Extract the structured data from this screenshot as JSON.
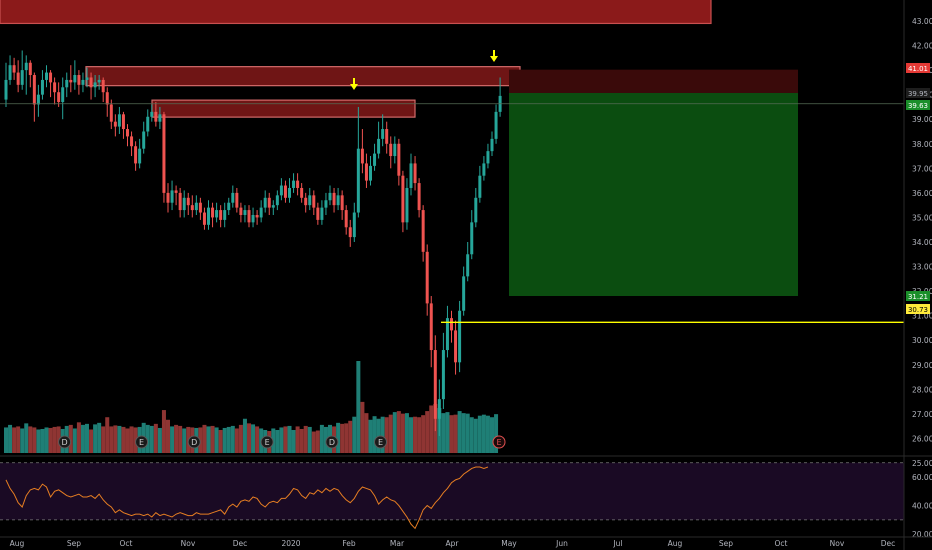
{
  "colors": {
    "background": "#000000",
    "grid": "#1c1c1c",
    "up_candle": "#26a69a",
    "down_candle": "#ef5350",
    "up_volume": "#1f7f76",
    "down_volume": "#8f3533",
    "resistance_zone": "#8b1a1a",
    "target_zone": "#0b4d10",
    "stop_zone": "#3a0a0a",
    "entry_line": "#ffff00",
    "arrow": "#ffff00",
    "rsi_line": "#e67e22",
    "rsi_band": "#1a0a24",
    "axis_text": "#b2b5be"
  },
  "chart_data": [
    {
      "type": "candlestick",
      "x_axis": {
        "tick_labels": [
          "Aug",
          "Sep",
          "Oct",
          "Nov",
          "Dec",
          "2020",
          "Feb",
          "Mar",
          "Apr",
          "May",
          "Jun",
          "Jul",
          "Aug",
          "Sep",
          "Oct",
          "Nov",
          "Dec"
        ]
      },
      "y_axis": {
        "side": "right",
        "ylim": [
          24.5,
          43.4
        ],
        "tick_labels": [
          "43.00",
          "42.00",
          "41.00",
          "40.00",
          "39.00",
          "38.00",
          "37.00",
          "36.00",
          "35.00",
          "34.00",
          "33.00",
          "32.00",
          "31.00",
          "30.00",
          "29.00",
          "28.00",
          "27.00",
          "26.00",
          "25.00"
        ],
        "tick_values": [
          43,
          42,
          41,
          40,
          39,
          38,
          37,
          36,
          35,
          34,
          33,
          32,
          31,
          30,
          29,
          28,
          27,
          26,
          25
        ]
      },
      "price_badges": [
        {
          "text": "41.01",
          "value": 41.01,
          "style": "red"
        },
        {
          "text": "39.95",
          "value": 39.95,
          "style": "dark"
        },
        {
          "text": "39.63",
          "value": 39.63,
          "style": "green"
        },
        {
          "text": "31.21",
          "value": 31.21,
          "style": "green"
        },
        {
          "text": "30.73",
          "value": 30.73,
          "style": "yellow"
        }
      ],
      "entry_level": 30.73,
      "zones": {
        "top_banner": {
          "from": "start",
          "to": "Sep mid",
          "high": 44.0,
          "low": 42.8
        },
        "resistance_upper": {
          "high": 41.1,
          "low": 40.3
        },
        "resistance_lower": {
          "high": 39.9,
          "low": 39.2
        },
        "trade_stop": {
          "high": 41.1,
          "low": 40.0
        },
        "trade_target": {
          "high": 40.0,
          "low": 31.0
        }
      },
      "arrows": [
        "Feb",
        "Apr late"
      ],
      "candles": [
        [
          39.8,
          40.6,
          41.3,
          39.5
        ],
        [
          40.6,
          41.2,
          41.6,
          40.4
        ],
        [
          41.2,
          40.9,
          41.5,
          40.6
        ],
        [
          40.9,
          40.4,
          41.4,
          40.1
        ],
        [
          40.4,
          41.0,
          41.8,
          40.2
        ],
        [
          41.0,
          41.3,
          41.6,
          40.0
        ],
        [
          41.3,
          40.8,
          41.4,
          40.3
        ],
        [
          40.8,
          39.6,
          40.9,
          38.9
        ],
        [
          39.6,
          40.0,
          40.4,
          39.1
        ],
        [
          40.0,
          40.6,
          41.0,
          39.8
        ],
        [
          40.6,
          40.9,
          41.2,
          40.3
        ],
        [
          40.9,
          40.5,
          41.0,
          39.9
        ],
        [
          40.5,
          40.1,
          40.7,
          39.6
        ],
        [
          40.1,
          39.7,
          40.5,
          39.5
        ],
        [
          39.7,
          40.3,
          40.7,
          39.0
        ],
        [
          40.3,
          40.6,
          40.9,
          39.9
        ],
        [
          40.6,
          40.5,
          41.2,
          40.1
        ],
        [
          40.5,
          40.8,
          41.4,
          40.2
        ],
        [
          40.8,
          40.4,
          41.0,
          40.0
        ],
        [
          40.4,
          40.6,
          40.9,
          40.1
        ],
        [
          40.6,
          40.7,
          41.1,
          40.3
        ],
        [
          40.7,
          40.3,
          40.9,
          39.8
        ],
        [
          40.3,
          40.5,
          40.8,
          39.9
        ],
        [
          40.5,
          40.6,
          40.8,
          40.2
        ],
        [
          40.6,
          40.1,
          40.7,
          39.7
        ],
        [
          40.1,
          39.6,
          40.3,
          39.1
        ],
        [
          39.6,
          38.9,
          39.8,
          38.6
        ],
        [
          38.9,
          38.7,
          39.2,
          38.3
        ],
        [
          38.7,
          39.2,
          39.5,
          38.4
        ],
        [
          39.2,
          38.6,
          39.3,
          38.2
        ],
        [
          38.6,
          38.3,
          38.8,
          37.9
        ],
        [
          38.3,
          37.9,
          38.5,
          37.5
        ],
        [
          37.9,
          37.2,
          38.1,
          36.9
        ],
        [
          37.2,
          37.8,
          38.2,
          37.0
        ],
        [
          37.8,
          38.5,
          38.9,
          37.6
        ],
        [
          38.5,
          39.1,
          39.4,
          38.3
        ],
        [
          39.1,
          39.3,
          39.6,
          38.9
        ],
        [
          39.3,
          38.9,
          39.7,
          38.7
        ],
        [
          38.9,
          39.2,
          39.5,
          38.6
        ],
        [
          39.2,
          36.0,
          39.3,
          35.6
        ],
        [
          36.0,
          35.6,
          36.4,
          35.2
        ],
        [
          35.6,
          36.1,
          36.5,
          35.3
        ],
        [
          36.1,
          36.0,
          36.3,
          35.5
        ],
        [
          36.0,
          35.3,
          36.2,
          35.0
        ],
        [
          35.3,
          35.8,
          36.1,
          35.0
        ],
        [
          35.8,
          35.5,
          36.0,
          35.1
        ],
        [
          35.5,
          35.3,
          35.9,
          35.0
        ],
        [
          35.3,
          35.6,
          35.9,
          35.1
        ],
        [
          35.6,
          35.2,
          35.8,
          34.9
        ],
        [
          35.2,
          34.7,
          35.4,
          34.5
        ],
        [
          34.7,
          35.4,
          35.7,
          34.5
        ],
        [
          35.4,
          35.0,
          35.6,
          34.6
        ],
        [
          35.0,
          35.3,
          35.6,
          34.8
        ],
        [
          35.3,
          34.9,
          35.5,
          34.6
        ],
        [
          34.9,
          35.3,
          35.6,
          34.6
        ],
        [
          35.3,
          35.6,
          35.8,
          35.1
        ],
        [
          35.6,
          36.0,
          36.3,
          35.4
        ],
        [
          36.0,
          35.4,
          36.2,
          35.2
        ],
        [
          35.4,
          35.1,
          35.6,
          34.8
        ],
        [
          35.1,
          35.3,
          35.5,
          34.8
        ],
        [
          35.3,
          34.8,
          35.5,
          34.6
        ],
        [
          34.8,
          35.1,
          35.4,
          34.6
        ],
        [
          35.1,
          35.0,
          35.3,
          34.7
        ],
        [
          35.0,
          35.4,
          35.7,
          34.8
        ],
        [
          35.4,
          35.8,
          36.1,
          35.2
        ],
        [
          35.8,
          35.4,
          36.0,
          35.1
        ],
        [
          35.4,
          35.5,
          35.7,
          35.1
        ],
        [
          35.5,
          35.9,
          36.1,
          35.3
        ],
        [
          35.9,
          36.3,
          36.6,
          35.7
        ],
        [
          36.3,
          35.8,
          36.5,
          35.6
        ],
        [
          35.8,
          36.2,
          36.6,
          35.6
        ],
        [
          36.2,
          36.5,
          36.8,
          36.0
        ],
        [
          36.5,
          36.2,
          36.8,
          35.9
        ],
        [
          36.2,
          35.8,
          36.4,
          35.6
        ],
        [
          35.8,
          35.5,
          36.0,
          35.2
        ],
        [
          35.5,
          35.9,
          36.2,
          35.3
        ],
        [
          35.9,
          35.4,
          36.1,
          35.1
        ],
        [
          35.4,
          34.9,
          35.6,
          34.7
        ],
        [
          34.9,
          35.4,
          35.7,
          34.7
        ],
        [
          35.4,
          35.7,
          36.0,
          35.1
        ],
        [
          35.7,
          36.0,
          36.3,
          35.5
        ],
        [
          36.0,
          35.5,
          36.2,
          35.2
        ],
        [
          35.5,
          35.9,
          36.2,
          35.3
        ],
        [
          35.9,
          35.3,
          36.1,
          34.9
        ],
        [
          35.3,
          34.6,
          35.5,
          34.3
        ],
        [
          34.6,
          34.2,
          34.9,
          33.8
        ],
        [
          34.2,
          35.2,
          35.6,
          34.0
        ],
        [
          35.2,
          37.8,
          39.5,
          35.0
        ],
        [
          37.8,
          37.2,
          38.6,
          36.8
        ],
        [
          37.2,
          36.5,
          37.6,
          36.2
        ],
        [
          36.5,
          37.1,
          37.5,
          36.3
        ],
        [
          37.1,
          37.6,
          38.0,
          36.9
        ],
        [
          37.6,
          38.2,
          38.9,
          37.4
        ],
        [
          38.2,
          38.6,
          39.2,
          37.9
        ],
        [
          38.6,
          38.0,
          38.9,
          37.6
        ],
        [
          38.0,
          37.5,
          38.3,
          37.0
        ],
        [
          37.5,
          38.0,
          38.3,
          37.2
        ],
        [
          38.0,
          36.7,
          38.2,
          36.3
        ],
        [
          36.7,
          34.8,
          36.9,
          34.4
        ],
        [
          34.8,
          36.2,
          36.6,
          34.5
        ],
        [
          36.2,
          37.2,
          37.6,
          35.9
        ],
        [
          37.2,
          36.4,
          37.5,
          36.1
        ],
        [
          36.4,
          35.3,
          36.6,
          35.0
        ],
        [
          35.3,
          33.6,
          35.5,
          33.2
        ],
        [
          33.6,
          31.5,
          33.9,
          31.0
        ],
        [
          31.5,
          29.6,
          31.8,
          28.9
        ],
        [
          29.6,
          26.8,
          30.2,
          26.3
        ],
        [
          26.8,
          27.6,
          28.4,
          26.1
        ],
        [
          27.6,
          29.6,
          30.3,
          27.2
        ],
        [
          29.6,
          30.9,
          31.4,
          29.3
        ],
        [
          30.9,
          30.4,
          31.2,
          29.9
        ],
        [
          30.4,
          29.1,
          30.8,
          28.6
        ],
        [
          29.1,
          31.2,
          31.6,
          28.7
        ],
        [
          31.2,
          32.6,
          33.0,
          31.0
        ],
        [
          32.6,
          33.5,
          34.0,
          32.4
        ],
        [
          33.5,
          34.8,
          35.3,
          33.3
        ],
        [
          34.8,
          35.8,
          36.2,
          34.6
        ],
        [
          35.8,
          36.7,
          37.1,
          35.6
        ],
        [
          36.7,
          37.2,
          37.5,
          36.5
        ],
        [
          37.2,
          37.7,
          38.0,
          37.0
        ],
        [
          37.7,
          38.2,
          38.5,
          37.5
        ],
        [
          38.2,
          39.3,
          39.6,
          38.0
        ],
        [
          39.3,
          39.95,
          40.7,
          39.1
        ]
      ],
      "volumes": [
        0.5,
        0.55,
        0.5,
        0.52,
        0.48,
        0.58,
        0.52,
        0.5,
        0.46,
        0.47,
        0.5,
        0.49,
        0.51,
        0.52,
        0.47,
        0.53,
        0.55,
        0.48,
        0.6,
        0.55,
        0.57,
        0.46,
        0.56,
        0.59,
        0.52,
        0.7,
        0.52,
        0.54,
        0.53,
        0.51,
        0.48,
        0.52,
        0.5,
        0.51,
        0.59,
        0.55,
        0.53,
        0.57,
        0.49,
        0.84,
        0.65,
        0.52,
        0.55,
        0.53,
        0.48,
        0.51,
        0.5,
        0.49,
        0.5,
        0.55,
        0.52,
        0.53,
        0.5,
        0.45,
        0.49,
        0.51,
        0.53,
        0.48,
        0.55,
        0.67,
        0.58,
        0.56,
        0.52,
        0.48,
        0.45,
        0.43,
        0.48,
        0.45,
        0.5,
        0.52,
        0.53,
        0.45,
        0.52,
        0.47,
        0.53,
        0.51,
        0.42,
        0.44,
        0.55,
        0.51,
        0.55,
        0.52,
        0.59,
        0.57,
        0.58,
        0.63,
        0.71,
        1.8,
        1.0,
        0.78,
        0.65,
        0.72,
        0.67,
        0.71,
        0.7,
        0.75,
        0.8,
        0.82,
        0.77,
        0.78,
        0.7,
        0.71,
        0.7,
        0.74,
        0.82,
        0.93,
        0.96,
        0.88,
        0.78,
        0.8,
        0.74,
        0.75,
        0.82,
        0.78,
        0.77,
        0.7,
        0.67,
        0.73,
        0.75,
        0.73,
        0.7,
        0.76
      ],
      "volume_markers": [
        {
          "label": "D",
          "at_candle": 12
        },
        {
          "label": "E",
          "at_candle": 31
        },
        {
          "label": "D",
          "at_candle": 44
        },
        {
          "label": "E",
          "at_candle": 62
        },
        {
          "label": "D",
          "at_candle": 78
        },
        {
          "label": "E",
          "at_candle": 90
        }
      ],
      "grid": false,
      "legend": "none"
    },
    {
      "type": "line",
      "name_shown": false,
      "y_axis": {
        "ylim": [
          18,
          74
        ],
        "tick_labels": [
          "60.00",
          "40.00",
          "20.00"
        ],
        "tick_values": [
          60,
          40,
          20
        ],
        "bands": [
          70,
          30
        ]
      },
      "values": [
        58,
        52,
        48,
        42,
        39,
        47,
        51,
        52,
        51,
        55,
        53,
        46,
        50,
        51,
        49,
        47,
        46,
        47,
        48,
        46,
        46,
        47,
        45,
        48,
        44,
        41,
        39,
        35,
        37,
        35,
        34,
        33,
        34,
        34,
        33,
        34,
        32,
        35,
        33,
        34,
        33,
        32,
        34,
        35,
        34,
        33,
        33,
        35,
        34,
        34,
        34,
        35,
        36,
        37,
        34,
        39,
        41,
        39,
        43,
        44,
        43,
        46,
        45,
        41,
        39,
        42,
        43,
        42,
        45,
        45,
        48,
        52,
        51,
        47,
        45,
        49,
        48,
        51,
        49,
        52,
        50,
        52,
        51,
        47,
        44,
        42,
        45,
        50,
        53,
        52,
        51,
        47,
        41,
        44,
        46,
        44,
        43,
        40,
        36,
        32,
        27,
        24,
        30,
        37,
        40,
        38,
        42,
        45,
        49,
        52,
        56,
        58,
        59,
        62,
        64,
        66,
        67,
        67,
        66,
        67
      ]
    }
  ]
}
